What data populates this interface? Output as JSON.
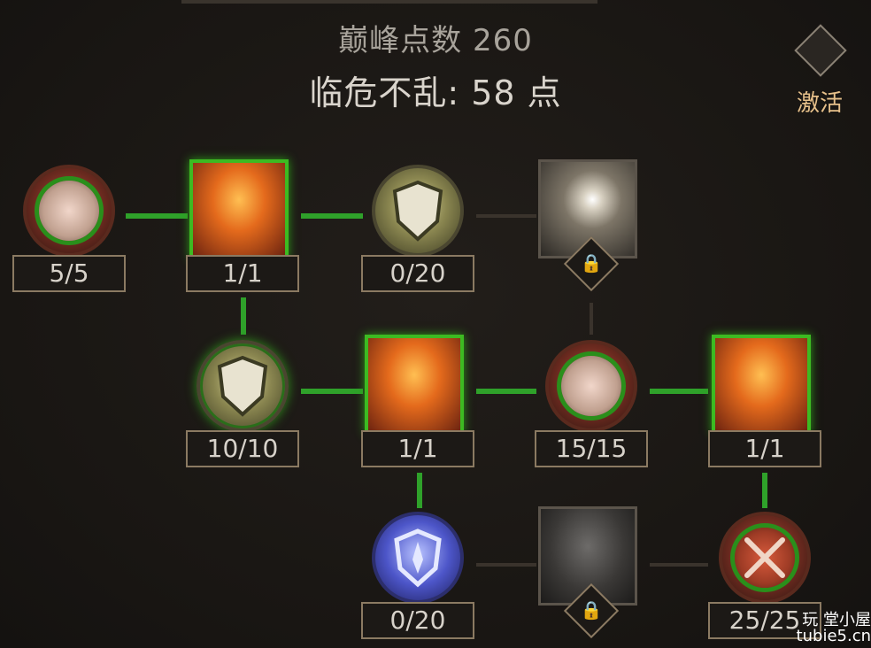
{
  "header": {
    "points_label": "巅峰点数 260",
    "skill_label": "临危不乱: 58 点"
  },
  "activate": {
    "label": "激活"
  },
  "nodes": [
    {
      "id": "r1c1",
      "counter": "5/5",
      "icon": "heart-icon"
    },
    {
      "id": "r1c2",
      "counter": "1/1",
      "icon": "fire-warrior-icon"
    },
    {
      "id": "r1c3",
      "counter": "0/20",
      "icon": "shield-icon"
    },
    {
      "id": "r1c4",
      "icon": "shining-shield-icon",
      "locked": true
    },
    {
      "id": "r2c2",
      "counter": "10/10",
      "icon": "shield-icon"
    },
    {
      "id": "r2c3",
      "counter": "1/1",
      "icon": "running-warrior-icon"
    },
    {
      "id": "r2c4",
      "counter": "15/15",
      "icon": "heart-icon"
    },
    {
      "id": "r2c5",
      "counter": "1/1",
      "icon": "bald-head-icon"
    },
    {
      "id": "r3c3",
      "counter": "0/20",
      "icon": "blue-shield-icon"
    },
    {
      "id": "r3c4",
      "icon": "helmet-icon",
      "locked": true
    },
    {
      "id": "r3c5",
      "counter": "25/25",
      "icon": "crossed-swords-icon"
    }
  ],
  "watermark": {
    "text": "玩 堂小屋 tubie5.cn"
  },
  "colors": {
    "active_link": "#2fa12a",
    "inactive_link": "#3a332c",
    "counter_border": "#8b7a62",
    "activate_text": "#e6c08a"
  }
}
